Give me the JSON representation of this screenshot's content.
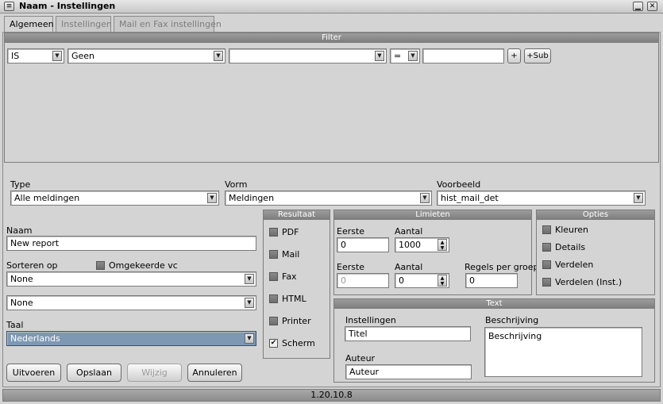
{
  "window": {
    "title": "Naam - Instellingen",
    "menu_icon": "≡",
    "minimize_icon": "▁",
    "close_icon": "✕"
  },
  "tabs": [
    {
      "label": "Algemeen",
      "active": true
    },
    {
      "label": "Instellingen",
      "active": false
    },
    {
      "label": "Mail en Fax instellingen",
      "active": false
    }
  ],
  "filter": {
    "title": "Filter",
    "field1": "IS",
    "field2": "Geen",
    "field3": "",
    "operator": "=",
    "value": "",
    "add_label": "+",
    "addsub_label": "+Sub"
  },
  "type": {
    "label": "Type",
    "value": "Alle meldingen"
  },
  "vorm": {
    "label": "Vorm",
    "value": "Meldingen"
  },
  "voorbeeld": {
    "label": "Voorbeeld",
    "value": "hist_mail_det"
  },
  "naam": {
    "label": "Naam",
    "value": "New report"
  },
  "sorteren": {
    "label": "Sorteren op",
    "reverse_label": "Omgekeerde vc",
    "value1": "None",
    "value2": "None"
  },
  "taal": {
    "label": "Taal",
    "value": "Nederlands"
  },
  "resultaat": {
    "title": "Resultaat",
    "items": [
      {
        "label": "PDF",
        "checked": false
      },
      {
        "label": "Mail",
        "checked": false
      },
      {
        "label": "Fax",
        "checked": false
      },
      {
        "label": "HTML",
        "checked": false
      },
      {
        "label": "Printer",
        "checked": false
      },
      {
        "label": "Scherm",
        "checked": true
      }
    ]
  },
  "limieten": {
    "title": "Limieten",
    "row1": {
      "eerste_label": "Eerste",
      "eerste_value": "0",
      "aantal_label": "Aantal",
      "aantal_value": "1000"
    },
    "row2": {
      "eerste_label": "Eerste",
      "eerste_value": "0",
      "aantal_label": "Aantal",
      "aantal_value": "0",
      "regels_label": "Regels per groep",
      "regels_value": "0"
    }
  },
  "opties": {
    "title": "Opties",
    "items": [
      {
        "label": "Kleuren",
        "checked": false
      },
      {
        "label": "Details",
        "checked": false
      },
      {
        "label": "Verdelen",
        "checked": false
      },
      {
        "label": "Verdelen (Inst.)",
        "checked": false
      }
    ]
  },
  "text": {
    "title": "Text",
    "instellingen_label": "Instellingen",
    "titel_value": "Titel",
    "auteur_label": "Auteur",
    "auteur_value": "Auteur",
    "beschrijving_label": "Beschrijving",
    "beschrijving_value": "Beschrijving"
  },
  "buttons": {
    "uitvoeren": "Uitvoeren",
    "opslaan": "Opslaan",
    "wijzig": "Wijzig",
    "annuleren": "Annuleren"
  },
  "status": {
    "version": "1.20.10.8"
  }
}
